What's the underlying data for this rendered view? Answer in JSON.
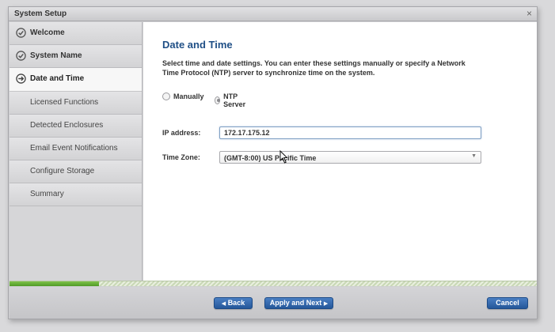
{
  "window": {
    "title": "System Setup",
    "close_glyph": "×"
  },
  "sidebar": {
    "items": [
      {
        "label": "Welcome",
        "state": "done",
        "icon": "check-circle-icon"
      },
      {
        "label": "System Name",
        "state": "done",
        "icon": "check-circle-icon"
      },
      {
        "label": "Date and Time",
        "state": "active",
        "icon": "arrow-circle-icon"
      },
      {
        "label": "Licensed Functions",
        "state": "pending"
      },
      {
        "label": "Detected Enclosures",
        "state": "pending"
      },
      {
        "label": "Email Event Notifications",
        "state": "pending"
      },
      {
        "label": "Configure Storage",
        "state": "pending"
      },
      {
        "label": "Summary",
        "state": "pending"
      }
    ]
  },
  "main": {
    "heading": "Date and Time",
    "description": "Select time and date settings. You can enter these settings manually or specify a Network Time Protocol (NTP) server to synchronize time on the system.",
    "mode_options": [
      {
        "label": "Manually",
        "selected": false
      },
      {
        "label": "NTP Server",
        "selected": true
      }
    ],
    "ip_label": "IP address:",
    "ip_value": "172.17.175.12",
    "timezone_label": "Time Zone:",
    "timezone_value": "(GMT-8:00) US Pacific Time"
  },
  "progress": {
    "fraction": 0.17
  },
  "footer": {
    "back_label": "Back",
    "next_label": "Apply and Next",
    "cancel_label": "Cancel"
  },
  "colors": {
    "heading": "#1f4f86",
    "button": "#2f65aa",
    "progress_fill": "#5fa830"
  }
}
